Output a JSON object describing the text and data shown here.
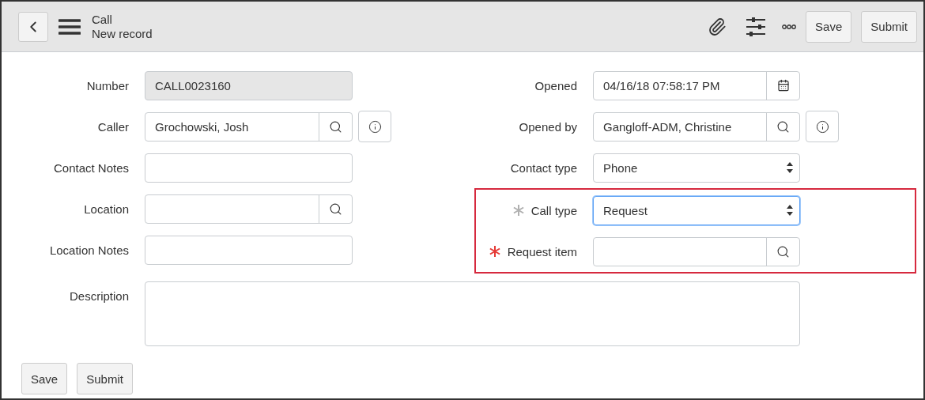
{
  "header": {
    "title": "Call",
    "subtitle": "New record",
    "buttons": [
      "Save",
      "Submit"
    ]
  },
  "left_fields": [
    {
      "label": "Number",
      "kind": "readonly",
      "value": "CALL0023160",
      "info": false,
      "required": false,
      "focused": false,
      "highlighted": false
    },
    {
      "label": "Caller",
      "kind": "reference",
      "value": "Grochowski, Josh",
      "info": true,
      "required": false,
      "focused": false,
      "highlighted": false
    },
    {
      "label": "Contact Notes",
      "kind": "text",
      "info": false,
      "required": false,
      "focused": false,
      "highlighted": false
    },
    {
      "label": "Location",
      "kind": "reference",
      "info": false,
      "required": false,
      "focused": false,
      "highlighted": false
    },
    {
      "label": "Location Notes",
      "kind": "text",
      "info": false,
      "required": false,
      "focused": false,
      "highlighted": false
    }
  ],
  "right_fields": [
    {
      "label": "Opened",
      "kind": "date",
      "value": "04/16/18 07:58:17 PM",
      "info": false,
      "required": false,
      "focused": false,
      "highlighted": false
    },
    {
      "label": "Opened by",
      "kind": "reference",
      "value": "Gangloff-ADM, Christine",
      "info": true,
      "required": false,
      "focused": false,
      "highlighted": false
    },
    {
      "label": "Contact type",
      "kind": "select",
      "value": "Phone",
      "info": false,
      "required": false,
      "focused": false,
      "highlighted": false
    },
    {
      "label": "Call type",
      "kind": "select",
      "value": "Request",
      "info": false,
      "required": true,
      "color": "#b0b0b0",
      "focused": true,
      "highlighted": true
    },
    {
      "label": "Request item",
      "kind": "reference",
      "info": false,
      "required": true,
      "color": "#e53935",
      "focused": false,
      "highlighted": true
    }
  ],
  "description": {
    "label": "Description"
  },
  "footer_buttons": [
    "Save",
    "Submit"
  ]
}
